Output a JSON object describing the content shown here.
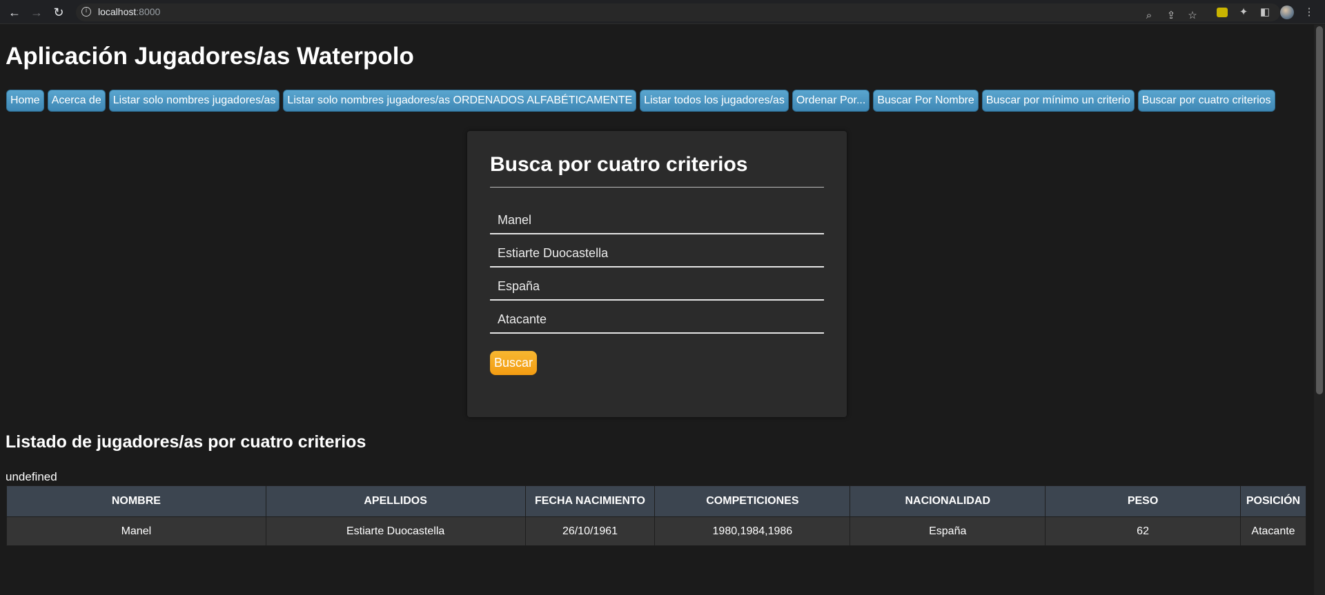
{
  "browser": {
    "url_host": "localhost",
    "url_port": ":8000"
  },
  "app": {
    "title": "Aplicación Jugadores/as Waterpolo"
  },
  "nav": {
    "items": [
      "Home",
      "Acerca de",
      "Listar solo nombres jugadores/as",
      "Listar solo nombres jugadores/as ORDENADOS ALFABÉTICAMENTE",
      "Listar todos los jugadores/as",
      "Ordenar Por...",
      "Buscar Por Nombre",
      "Buscar por mínimo un criterio",
      "Buscar por cuatro criterios"
    ]
  },
  "form": {
    "title": "Busca por cuatro criterios",
    "fields": [
      "Manel",
      "Estiarte Duocastella",
      "España",
      "Atacante"
    ],
    "submit_label": "Buscar"
  },
  "results": {
    "title": "Listado de jugadores/as por cuatro criterios",
    "note": "undefined",
    "headers": [
      "NOMBRE",
      "APELLIDOS",
      "FECHA NACIMIENTO",
      "COMPETICIONES",
      "NACIONALIDAD",
      "PESO",
      "POSICIÓN"
    ],
    "rows": [
      [
        "Manel",
        "Estiarte Duocastella",
        "26/10/1961",
        "1980,1984,1986",
        "España",
        "62",
        "Atacante"
      ]
    ]
  },
  "colors": {
    "nav_button": "#4a96c2",
    "submit_button": "#f5a623",
    "table_header": "#3c4550",
    "background": "#1b1b1b"
  }
}
